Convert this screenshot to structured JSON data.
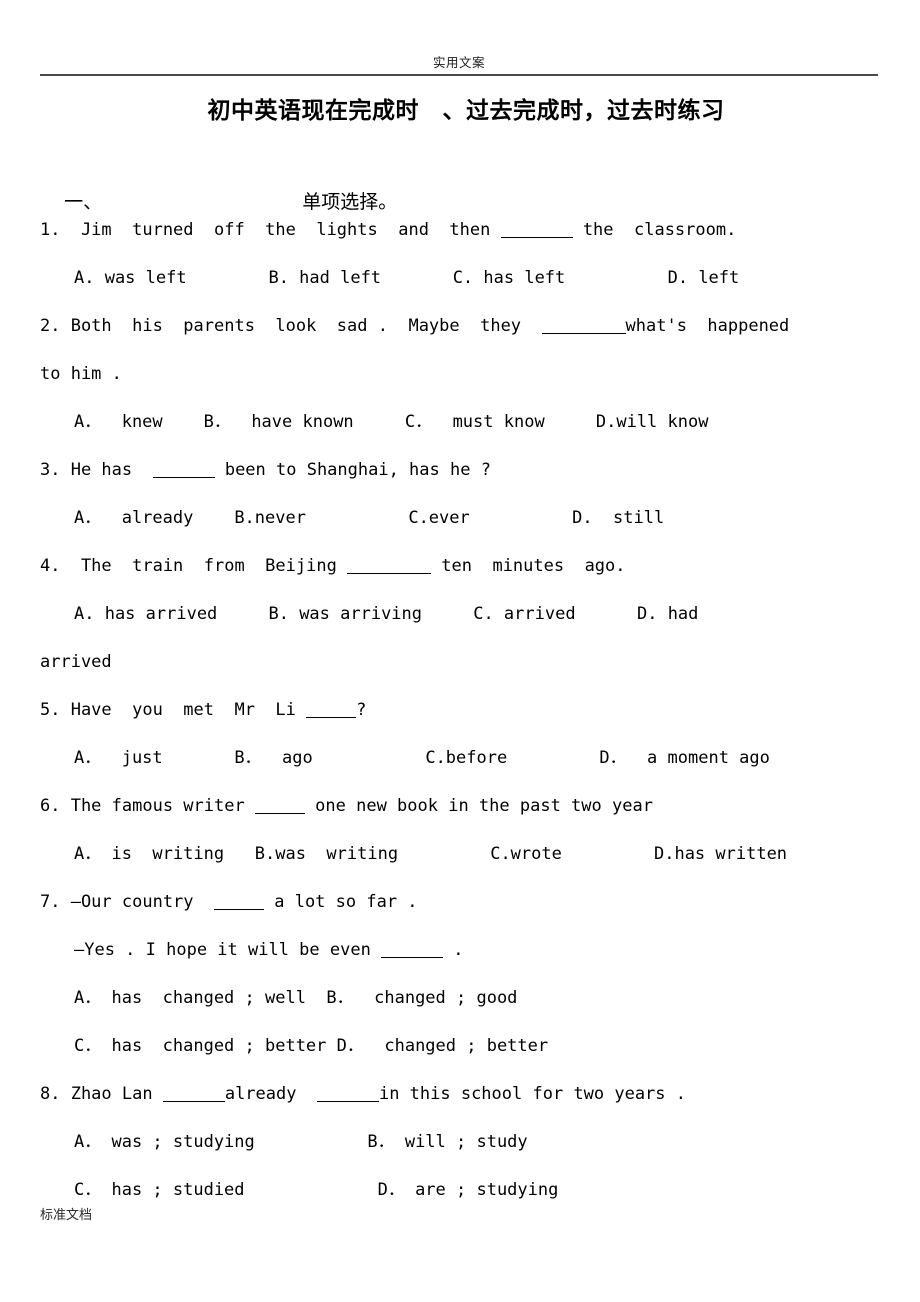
{
  "page": {
    "header_text": "实用文案",
    "footer_text": "标准文档",
    "title": "初中英语现在完成时　、过去完成时，过去时练习"
  },
  "section": {
    "number": "一、",
    "label": "单项选择。"
  },
  "questions": [
    {
      "id": "q1",
      "stem_pre": "1.  Jim  turned  off  the  lights  and  then ",
      "stem_post": " the  classroom.",
      "options_line1": "A. was left        B. had left       C. has left          D. left",
      "opt_a": "A. was left",
      "opt_b": "B. had left",
      "opt_c": "C. has left",
      "opt_d": "D. left"
    },
    {
      "id": "q2",
      "stem_pre": "2. Both  his  parents  look  sad .  Maybe  they  ",
      "stem_post": "what's  happened",
      "stem_wrap": "to him .",
      "opt_a": "A．  knew",
      "opt_b": "B．  have known",
      "opt_c": "C．  must know",
      "opt_d": "D.will know"
    },
    {
      "id": "q3",
      "stem_pre": "3. He has  ",
      "stem_post": " been to Shanghai, has he ?",
      "opt_a": "A．  already",
      "opt_b": "B.never",
      "opt_c": "C.ever",
      "opt_d": "D.  still"
    },
    {
      "id": "q4",
      "stem_pre": "4.  The  train  from  Beijing ",
      "stem_post": " ten  minutes  ago.",
      "stem_wrap": "arrived",
      "opt_a": "A. has arrived",
      "opt_b": "B. was arriving",
      "opt_c": "C. arrived",
      "opt_d": "D. had"
    },
    {
      "id": "q5",
      "stem_pre": "5. Have  you  met  Mr  Li ",
      "stem_post": "?",
      "opt_a": "A．  just",
      "opt_b": "B．  ago",
      "opt_c": "C.before",
      "opt_d": "D．  a moment ago"
    },
    {
      "id": "q6",
      "stem_pre": "6. The famous writer ",
      "stem_post": " one new book in the past two year",
      "opt_a": "A． is  writing",
      "opt_b": "B.was  writing",
      "opt_c": "C.wrote",
      "opt_d": "D.has written"
    },
    {
      "id": "q7",
      "stem_pre": "7. —Our country  ",
      "stem_post": " a lot so far .",
      "stem_line2_pre": "—Yes . I hope it will be even ",
      "stem_line2_post": " .",
      "opt_ab": "A． has  changed ; well   B．  changed ; good",
      "opt_cd": "C． has  changed ; better  D．  changed ; better",
      "opt_a": "A． has  changed ; well",
      "opt_b": "B．  changed ; good",
      "opt_c": "C． has  changed ; better",
      "opt_d": "D．  changed ; better"
    },
    {
      "id": "q8",
      "stem_pre": "8. Zhao Lan ",
      "stem_mid": "already  ",
      "stem_post": "in this school for two years .",
      "opt_a": "A． was ; studying",
      "opt_b": "B． will ; study",
      "opt_c": "C． has ; studied",
      "opt_d": "D． are ; studying"
    }
  ]
}
